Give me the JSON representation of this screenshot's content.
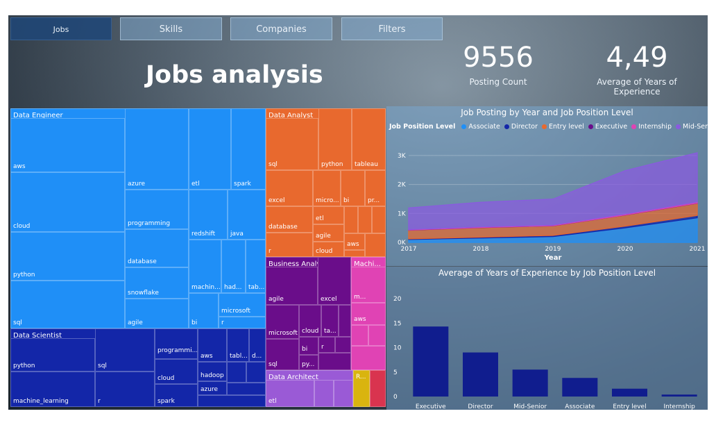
{
  "nav": {
    "tabs": [
      "Jobs",
      "Skills",
      "Companies",
      "Filters"
    ]
  },
  "title": "Jobs analysis",
  "kpis": {
    "posting_count": {
      "value": "9556",
      "label": "Posting Count"
    },
    "avg_experience": {
      "value": "4,49",
      "label": "Average of Years of Experience"
    }
  },
  "treemap": {
    "groups": [
      {
        "name": "Data Engineer",
        "color": "#1f8ff7",
        "skills": [
          "aws",
          "cloud",
          "python",
          "sql",
          "azure",
          "etl",
          "spark",
          "programming",
          "redshift",
          "java",
          "database",
          "snowflake",
          "agile",
          "machin...",
          "had...",
          "tab...",
          "microsoft",
          "bi",
          "r"
        ]
      },
      {
        "name": "Data Scientist",
        "color": "#1326a8",
        "skills": [
          "python",
          "machine_learning",
          "sql",
          "r",
          "programmi...",
          "aws",
          "tabl...",
          "d...",
          "cloud",
          "hadoop",
          "azure",
          "spark"
        ]
      },
      {
        "name": "Data Analyst",
        "color": "#e8692e",
        "skills": [
          "sql",
          "python",
          "tableau",
          "excel",
          "micro...",
          "bi",
          "pr...",
          "database",
          "etl",
          "agile",
          "r",
          "cloud",
          "aws"
        ]
      },
      {
        "name": "Business Analyst",
        "color": "#6a0d8a",
        "skills": [
          "agile",
          "excel",
          "microsoft",
          "cloud",
          "ta...",
          "bi",
          "r",
          "sql",
          "py..."
        ]
      },
      {
        "name": "Machi...",
        "color": "#e043b4",
        "skills": [
          "m...",
          "aws"
        ]
      },
      {
        "name": "Data Architect",
        "color": "#9a5ad6",
        "skills": [
          "etl",
          "R..."
        ]
      }
    ]
  },
  "line_chart": {
    "title": "Job Posting by Year and Job Position Level",
    "legend_title": "Job Position Level",
    "xlabel": "Year",
    "x_ticks": [
      "2017",
      "2018",
      "2019",
      "2020",
      "2021"
    ],
    "y_ticks": [
      "0K",
      "1K",
      "2K",
      "3K"
    ],
    "chart_data": {
      "type": "area",
      "x": [
        2017,
        2018,
        2019,
        2020,
        2021
      ],
      "ylim": [
        0,
        3500
      ],
      "stacked": true,
      "series": [
        {
          "name": "Associate",
          "color": "#1f8ff7",
          "values": [
            100,
            150,
            200,
            500,
            850
          ]
        },
        {
          "name": "Director",
          "color": "#1326a8",
          "values": [
            20,
            30,
            40,
            60,
            80
          ]
        },
        {
          "name": "Entry level",
          "color": "#e8692e",
          "values": [
            300,
            330,
            330,
            380,
            420
          ]
        },
        {
          "name": "Executive",
          "color": "#6a0d8a",
          "values": [
            5,
            5,
            5,
            5,
            5
          ]
        },
        {
          "name": "Internship",
          "color": "#e043b4",
          "values": [
            15,
            20,
            20,
            30,
            40
          ]
        },
        {
          "name": "Mid-Senior...",
          "color": "#8a5ae0",
          "values": [
            750,
            850,
            900,
            1500,
            1700
          ]
        }
      ]
    }
  },
  "bar_chart": {
    "title": "Average of Years of Experience by Job Position Level",
    "y_ticks": [
      "0",
      "5",
      "10",
      "15",
      "20"
    ],
    "chart_data": {
      "type": "bar",
      "categories": [
        "Executive",
        "Director",
        "Mid-Senior level",
        "Associate",
        "Entry level",
        "Internship"
      ],
      "values": [
        14.3,
        9.0,
        5.5,
        3.8,
        1.6,
        0.4
      ],
      "ylim": [
        0,
        20
      ],
      "color": "#101d8e"
    }
  }
}
